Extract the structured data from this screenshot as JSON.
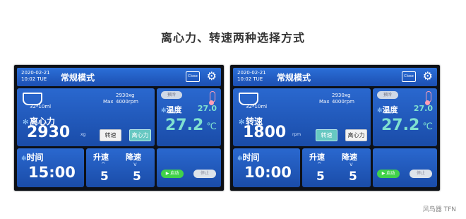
{
  "caption": "离心力、转速两种选择方式",
  "footer": "风鸟器 TFN",
  "screens": [
    {
      "date": "2020-02-21",
      "time": "10:02 TUE",
      "mode": "常规模式",
      "close_label": "Close",
      "rotor_spec": "32*10ml",
      "max_g": "2930xg",
      "max_label": "Max",
      "max_rpm": "4000rpm",
      "param_title": "离心力",
      "param_value": "2930",
      "param_unit": "xg",
      "btn_speed": "转速",
      "btn_force": "离心力",
      "active": "force",
      "temp_pill": "预冷",
      "temp_title": "温度",
      "temp_set": "27.0",
      "temp_value": "27.2",
      "temp_unit": "℃",
      "time_title": "时间",
      "time_value": "15:00",
      "accel_label": "升速",
      "decel_label": "降速",
      "accel_value": "5",
      "decel_value": "5",
      "start_label": "▶ 启动",
      "stop_label": "停止"
    },
    {
      "date": "2020-02-21",
      "time": "10:02 TUE",
      "mode": "常规模式",
      "close_label": "Close",
      "rotor_spec": "32*10ml",
      "max_g": "2930xg",
      "max_label": "Max",
      "max_rpm": "4000rpm",
      "param_title": "转速",
      "param_value": "1800",
      "param_unit": "rpm",
      "btn_speed": "转速",
      "btn_force": "离心力",
      "active": "speed",
      "temp_pill": "预冷",
      "temp_title": "温度",
      "temp_set": "27.0",
      "temp_value": "27.2",
      "temp_unit": "℃",
      "time_title": "时间",
      "time_value": "10:00",
      "accel_label": "升速",
      "decel_label": "降速",
      "accel_value": "5",
      "decel_value": "5",
      "start_label": "▶ 启动",
      "stop_label": "停止"
    }
  ]
}
